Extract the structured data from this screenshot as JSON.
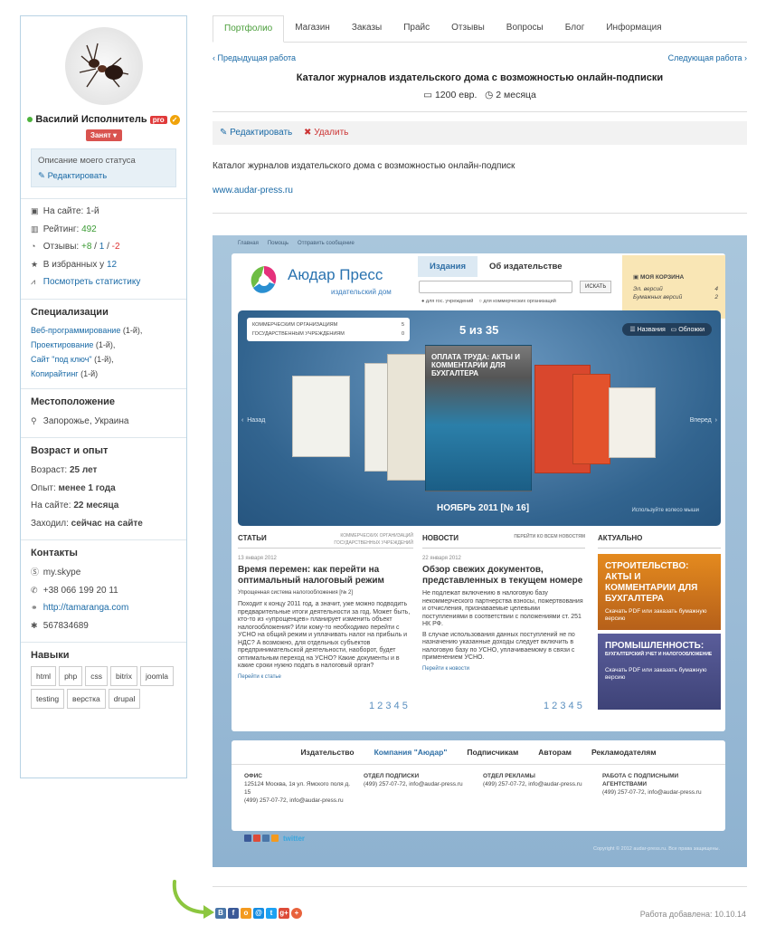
{
  "profile": {
    "name": "Василий Исполнитель",
    "pro": "pro",
    "busy": "Занят ▾",
    "status_text": "Описание моего статуса",
    "edit": "Редактировать",
    "on_site": "На сайте: 1-й",
    "rating_label": "Рейтинг:",
    "rating": "492",
    "reviews_label": "Отзывы:",
    "reviews_pos": "+8",
    "reviews_sep1": "/",
    "reviews_neu": "1",
    "reviews_sep2": "/",
    "reviews_neg": "-2",
    "fav_label": "В избранных у",
    "fav": "12",
    "stats": "Посмотреть статистику"
  },
  "specializations": {
    "title": "Специализации",
    "items": [
      {
        "name": "Веб-программирование",
        "rank": "(1-й),"
      },
      {
        "name": "Проектирование",
        "rank": "(1-й),"
      },
      {
        "name": "Сайт \"под ключ\"",
        "rank": "(1-й),"
      },
      {
        "name": "Копирайтинг",
        "rank": "(1-й)"
      }
    ]
  },
  "location": {
    "title": "Местоположение",
    "value": "Запорожье, Украина"
  },
  "experience": {
    "title": "Возраст и опыт",
    "age_label": "Возраст:",
    "age": "25 лет",
    "exp_label": "Опыт:",
    "exp": "менее 1 года",
    "site_label": "На сайте:",
    "site": "22 месяца",
    "visit_label": "Заходил:",
    "visit": "сейчас на сайте"
  },
  "contacts": {
    "title": "Контакты",
    "skype": "my.skype",
    "phone": "+38 066 199 20 11",
    "site": "http://tamaranga.com",
    "icq": "567834689"
  },
  "skills": {
    "title": "Навыки",
    "items": [
      "html",
      "php",
      "css",
      "bitrix",
      "joomla",
      "testing",
      "верстка",
      "drupal"
    ]
  },
  "tabs": [
    "Портфолио",
    "Магазин",
    "Заказы",
    "Прайс",
    "Отзывы",
    "Вопросы",
    "Блог",
    "Информация"
  ],
  "work": {
    "prev": "‹ Предыдущая работа",
    "next": "Следующая работа ›",
    "title": "Каталог журналов издательского дома с возможностью онлайн-подписки",
    "price": "1200 евр.",
    "duration": "2 месяца",
    "edit": "Редактировать",
    "delete": "Удалить",
    "description": "Каталог журналов издательского дома с возможностью онлайн-подписк",
    "url": "www.audar-press.ru",
    "added": "Работа добавлена: 10.10.14"
  },
  "shot": {
    "topnav": [
      "Главная",
      "Помощь",
      "Отправить сообщение"
    ],
    "brand": "Аюдар Пресс",
    "brand_sub": "издательский дом",
    "tab1": "Издания",
    "tab2": "Об издательстве",
    "search_btn": "ИСКАТЬ",
    "radio1": "для гос. учреждений",
    "radio2": "для коммерческих организаций",
    "cart_title": "МОЯ КОРЗИНА",
    "cart_e": "Эл. версий",
    "cart_e_n": "4",
    "cart_p": "Бумажных версий",
    "cart_p_n": "2",
    "cat1": "КОММЕРЧЕСКИМ ОРГАНИЗАЦИЯМ",
    "cat1_n": "5",
    "cat2": "ГОСУДАРСТВЕННЫМ УЧРЕЖДЕНИЯМ",
    "cat2_n": "0",
    "count": "5 из 35",
    "view1": "Названия",
    "view2": "Обложки",
    "back": "Назад",
    "fwd": "Вперед",
    "month": "НОЯБРЬ 2011 [№ 16]",
    "scroll_hint": "Используйте колесо мыши",
    "cover_title": "ОПЛАТА ТРУДА: АКТЫ И КОММЕНТАРИИ ДЛЯ БУХГАЛТЕРА",
    "col1_title": "СТАТЬИ",
    "col1_f1": "КОММЕРЧЕСКИХ ОРГАНИЗАЦИЙ",
    "col1_f2": "ГОСУДАРСТВЕННЫХ УЧРЕЖДЕНИЙ",
    "col1_date": "13 января 2012",
    "col1_head": "Время перемен: как перейти на оптимальный налоговый режим",
    "col1_tag": "Упрощенная система налогообложения [№ 2]",
    "col1_text": "Походит к концу 2011 год, а значит, уже можно подводить предварительные итоги деятельности за год. Может быть, кто-то из «упрощенцев» планирует изменить объект налогообложения? Или кому-то необходимо перейти с УСНО на общий режим и уплачивать налог на прибыль и НДС? А возможно, для отдельных субъектов предпринимательской деятельности, наоборот, будет оптимальным переход на УСНО? Какие документы и в какие сроки нужно подать в налоговый орган?",
    "col1_more": "Перейти к статье",
    "col2_title": "НОВОСТИ",
    "col2_all": "ПЕРЕЙТИ КО ВСЕМ НОВОСТЯМ",
    "col2_date": "22 января 2012",
    "col2_head": "Обзор свежих документов, представленных в текущем номере",
    "col2_text": "Не подлежат включению в налоговую базу некоммерческого партнерства взносы, пожертвования и отчисления, признаваемые целевыми поступлениями в соответствии с положениями ст. 251 НК РФ.",
    "col2_text2": "В случае использования данных поступлений не по назначению указанные доходы следует включить в налоговую базу по УСНО, уплачиваемому в связи с применением УСНО.",
    "col2_more": "Перейти к новости",
    "col3_title": "АКТУАЛЬНО",
    "promo1": "СТРОИТЕЛЬСТВО: АКТЫ И КОММЕНТАРИИ ДЛЯ БУХГАЛТЕРА",
    "promo1_sub": "Скачать PDF или заказать бумажную версию",
    "promo2": "ПРОМЫШЛЕННОСТЬ:",
    "promo2_line": "БУХГАЛТЕРСКИЙ УЧЕТ И НАЛОГООБЛОЖЕНИЕ",
    "promo2_sub": "Скачать PDF или заказать бумажную версию",
    "pages": "1 2 3 4 5",
    "fnav": [
      "Издательство",
      "Компания \"Аюдар\"",
      "Подписчикам",
      "Авторам",
      "Рекламодателям"
    ],
    "f1_title": "ОФИС",
    "f1_text": "125124 Москва, 1я ул. Ямского поля д. 15",
    "f1_phone": "(499) 257-07-72, info@audar-press.ru",
    "f2_title": "ОТДЕЛ ПОДПИСКИ",
    "f2_phone": "(499) 257-07-72, info@audar-press.ru",
    "f3_title": "ОТДЕЛ РЕКЛАМЫ",
    "f3_phone": "(499) 257-07-72, info@audar-press.ru",
    "f4_title": "РАБОТА С ПОДПИСНЫМИ АГЕНТСТВАМИ",
    "f4_phone": "(499) 257-07-72, info@audar-press.ru",
    "twitter": "twitter",
    "copyright": "Copyright © 2012 audar-press.ru. Все права защищены."
  },
  "share": [
    {
      "name": "vk-icon",
      "glyph": "B",
      "color": "#4a76a8"
    },
    {
      "name": "facebook-icon",
      "glyph": "f",
      "color": "#3b5998"
    },
    {
      "name": "odnoklassniki-icon",
      "glyph": "о",
      "color": "#f39a1f"
    },
    {
      "name": "mailru-icon",
      "glyph": "@",
      "color": "#168de2"
    },
    {
      "name": "twitter-icon",
      "glyph": "t",
      "color": "#1da1f2"
    },
    {
      "name": "googleplus-icon",
      "glyph": "g+",
      "color": "#dd4b39"
    },
    {
      "name": "more-icon",
      "glyph": "+",
      "color": "#e8623c"
    }
  ]
}
